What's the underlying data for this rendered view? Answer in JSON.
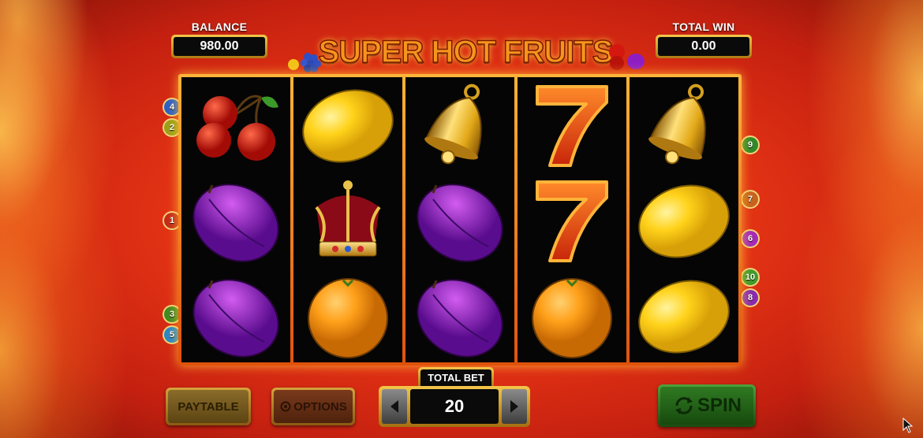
{
  "balance": {
    "label": "BALANCE",
    "value": "980.00"
  },
  "total_win": {
    "label": "TOTAL WIN",
    "value": "0.00"
  },
  "logo": {
    "text": "SUPER HOT FRUITS"
  },
  "reels": [
    [
      "cherries",
      "plum",
      "plum"
    ],
    [
      "lemon",
      "crown",
      "orange"
    ],
    [
      "bell",
      "plum",
      "plum"
    ],
    [
      "seven",
      "seven",
      "orange"
    ],
    [
      "bell",
      "lemon",
      "lemon"
    ]
  ],
  "paylines": {
    "left": [
      {
        "num": "4",
        "color": "#2d5fc4"
      },
      {
        "num": "2",
        "color": "#9aa018"
      },
      {
        "num": "1",
        "color": "#c42a1a"
      },
      {
        "num": "3",
        "color": "#3f8a22"
      },
      {
        "num": "5",
        "color": "#2a86c4"
      }
    ],
    "right": [
      {
        "num": "9",
        "color": "#2e8a2a"
      },
      {
        "num": "7",
        "color": "#c8621c"
      },
      {
        "num": "6",
        "color": "#a52ab8"
      },
      {
        "num": "10",
        "color": "#3f9a2e"
      },
      {
        "num": "8",
        "color": "#8a2ab0"
      }
    ]
  },
  "controls": {
    "paytable_label": "PAYTABLE",
    "options_label": "OPTIONS",
    "total_bet_label": "TOTAL BET",
    "total_bet_value": "20",
    "spin_label": "SPIN"
  }
}
